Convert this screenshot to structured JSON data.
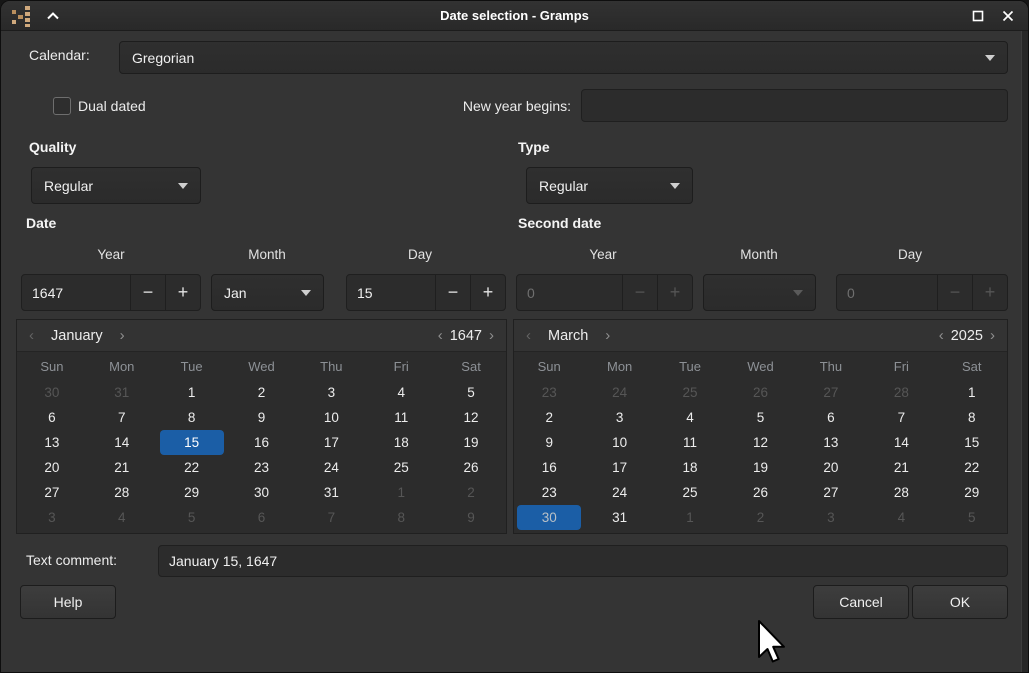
{
  "titlebar": {
    "title": "Date selection - Gramps"
  },
  "fields": {
    "calendar_label": "Calendar:",
    "calendar_value": "Gregorian",
    "dual_dated_label": "Dual dated",
    "dual_dated_checked": false,
    "new_year_label": "New year begins:",
    "new_year_value": "",
    "quality_label": "Quality",
    "quality_value": "Regular",
    "type_label": "Type",
    "type_value": "Regular",
    "date_label": "Date",
    "second_date_label": "Second date",
    "col_year": "Year",
    "col_month": "Month",
    "col_day": "Day",
    "date_year": "1647",
    "date_month": "Jan",
    "date_day": "15",
    "second_year": "0",
    "second_month": "",
    "second_day": "0",
    "text_comment_label": "Text comment:",
    "text_comment_value": "January 15, 1647"
  },
  "buttons": {
    "help": "Help",
    "cancel": "Cancel",
    "ok": "OK"
  },
  "glyphs": {
    "minus": "−",
    "plus": "+",
    "prev": "‹",
    "next": "›"
  },
  "colors": {
    "selection_blue": "#1b5ea6",
    "app_icon_tan": "#cfa97d"
  },
  "calendars": [
    {
      "month": "January",
      "year": "1647",
      "weekdays": [
        "Sun",
        "Mon",
        "Tue",
        "Wed",
        "Thu",
        "Fri",
        "Sat"
      ],
      "weeks": [
        [
          {
            "t": "30",
            "muted": true
          },
          {
            "t": "31",
            "muted": true
          },
          {
            "t": "1"
          },
          {
            "t": "2"
          },
          {
            "t": "3"
          },
          {
            "t": "4"
          },
          {
            "t": "5"
          }
        ],
        [
          {
            "t": "6"
          },
          {
            "t": "7"
          },
          {
            "t": "8"
          },
          {
            "t": "9"
          },
          {
            "t": "10"
          },
          {
            "t": "11"
          },
          {
            "t": "12"
          }
        ],
        [
          {
            "t": "13"
          },
          {
            "t": "14"
          },
          {
            "t": "15",
            "selected": true
          },
          {
            "t": "16"
          },
          {
            "t": "17"
          },
          {
            "t": "18"
          },
          {
            "t": "19"
          }
        ],
        [
          {
            "t": "20"
          },
          {
            "t": "21"
          },
          {
            "t": "22"
          },
          {
            "t": "23"
          },
          {
            "t": "24"
          },
          {
            "t": "25"
          },
          {
            "t": "26"
          }
        ],
        [
          {
            "t": "27"
          },
          {
            "t": "28"
          },
          {
            "t": "29"
          },
          {
            "t": "30"
          },
          {
            "t": "31"
          },
          {
            "t": "1",
            "muted": true
          },
          {
            "t": "2",
            "muted": true
          }
        ],
        [
          {
            "t": "3",
            "muted": true
          },
          {
            "t": "4",
            "muted": true
          },
          {
            "t": "5",
            "muted": true
          },
          {
            "t": "6",
            "muted": true
          },
          {
            "t": "7",
            "muted": true
          },
          {
            "t": "8",
            "muted": true
          },
          {
            "t": "9",
            "muted": true
          }
        ]
      ]
    },
    {
      "month": "March",
      "year": "2025",
      "weekdays": [
        "Sun",
        "Mon",
        "Tue",
        "Wed",
        "Thu",
        "Fri",
        "Sat"
      ],
      "weeks": [
        [
          {
            "t": "23",
            "muted": true
          },
          {
            "t": "24",
            "muted": true
          },
          {
            "t": "25",
            "muted": true
          },
          {
            "t": "26",
            "muted": true
          },
          {
            "t": "27",
            "muted": true
          },
          {
            "t": "28",
            "muted": true
          },
          {
            "t": "1"
          }
        ],
        [
          {
            "t": "2"
          },
          {
            "t": "3"
          },
          {
            "t": "4"
          },
          {
            "t": "5"
          },
          {
            "t": "6"
          },
          {
            "t": "7"
          },
          {
            "t": "8"
          }
        ],
        [
          {
            "t": "9"
          },
          {
            "t": "10"
          },
          {
            "t": "11"
          },
          {
            "t": "12"
          },
          {
            "t": "13"
          },
          {
            "t": "14"
          },
          {
            "t": "15"
          }
        ],
        [
          {
            "t": "16"
          },
          {
            "t": "17"
          },
          {
            "t": "18"
          },
          {
            "t": "19"
          },
          {
            "t": "20"
          },
          {
            "t": "21"
          },
          {
            "t": "22"
          }
        ],
        [
          {
            "t": "23"
          },
          {
            "t": "24"
          },
          {
            "t": "25"
          },
          {
            "t": "26"
          },
          {
            "t": "27"
          },
          {
            "t": "28"
          },
          {
            "t": "29"
          }
        ],
        [
          {
            "t": "30",
            "selected": true,
            "dim": true
          },
          {
            "t": "31"
          },
          {
            "t": "1",
            "muted": true
          },
          {
            "t": "2",
            "muted": true
          },
          {
            "t": "3",
            "muted": true
          },
          {
            "t": "4",
            "muted": true
          },
          {
            "t": "5",
            "muted": true
          }
        ]
      ]
    }
  ]
}
